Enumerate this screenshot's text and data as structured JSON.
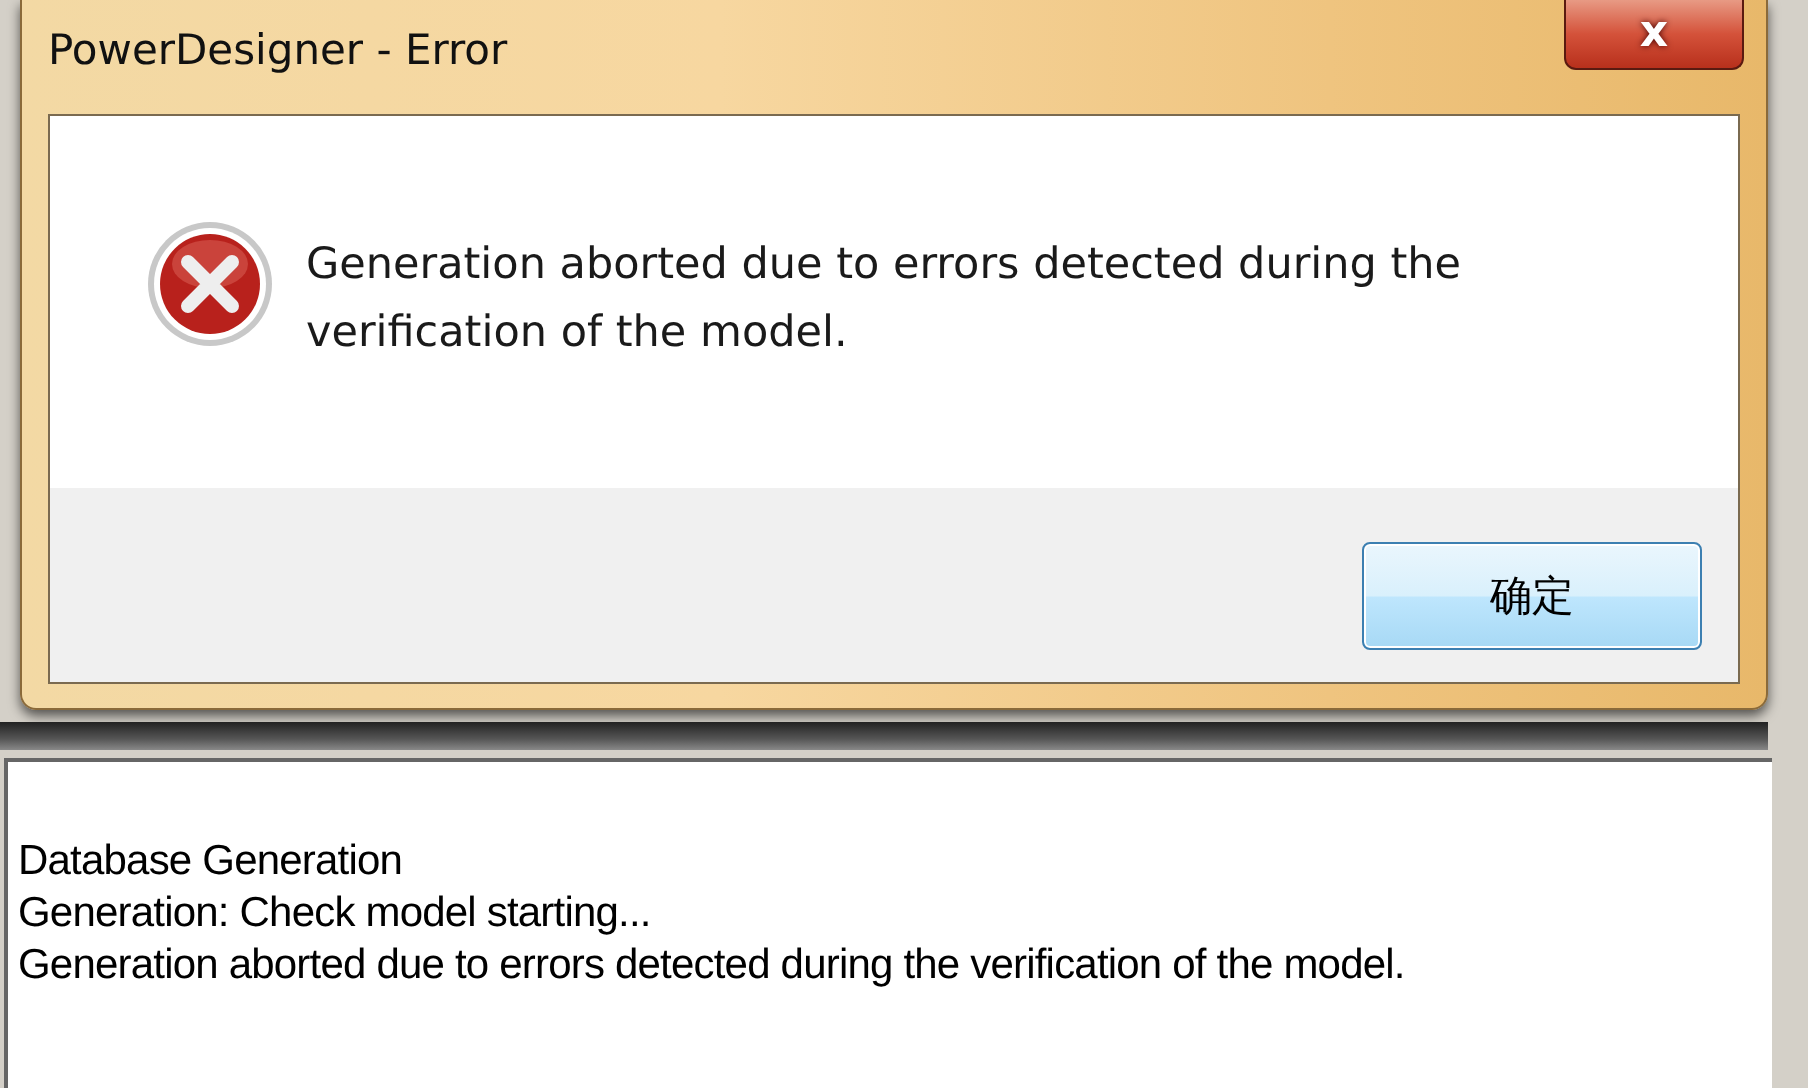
{
  "dialog": {
    "title": "PowerDesigner - Error",
    "close_label": "x",
    "message": "Generation aborted due to errors detected during the verification of the model.",
    "buttons": [
      {
        "label": "确定",
        "selected": true
      }
    ]
  },
  "output_log": {
    "lines": [
      "Database Generation",
      "Generation: Check model starting...",
      "Generation aborted due to errors detected during the verification of the model."
    ]
  }
}
